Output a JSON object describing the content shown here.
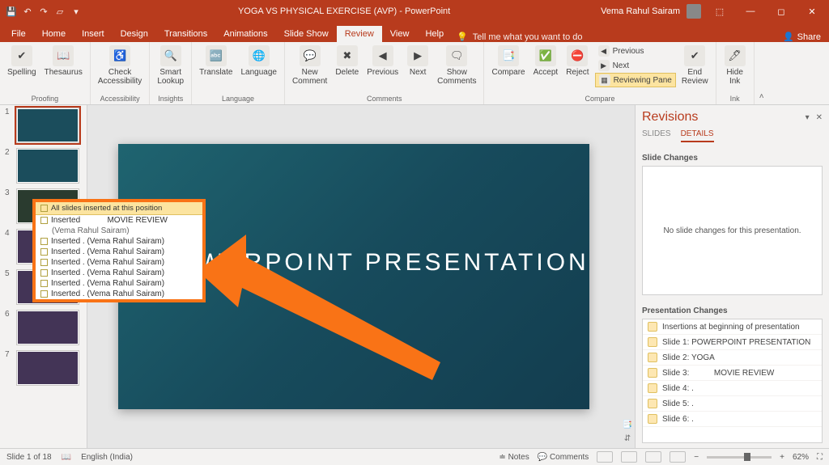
{
  "title": "YOGA VS PHYSICAL EXERCISE (AVP)  -  PowerPoint",
  "user": "Vema Rahul Sairam",
  "tabs": [
    "File",
    "Home",
    "Insert",
    "Design",
    "Transitions",
    "Animations",
    "Slide Show",
    "Review",
    "View",
    "Help"
  ],
  "active_tab": "Review",
  "tellme": "Tell me what you want to do",
  "share": "Share",
  "ribbon": {
    "proofing": {
      "spelling": "Spelling",
      "thesaurus": "Thesaurus"
    },
    "acc": "Check\nAccessibility",
    "insights": "Smart\nLookup",
    "lang": {
      "translate": "Translate",
      "language": "Language"
    },
    "comments": {
      "new": "New\nComment",
      "del": "Delete",
      "prev": "Previous",
      "next": "Next",
      "show": "Show\nComments"
    },
    "compare": {
      "compare": "Compare",
      "accept": "Accept",
      "reject": "Reject",
      "previous": "Previous",
      "nextr": "Next",
      "pane": "Reviewing Pane",
      "end": "End\nReview"
    },
    "ink": "Hide\nInk",
    "caps": [
      "Proofing",
      "Accessibility",
      "Insights",
      "Language",
      "Comments",
      "Compare",
      "Ink"
    ]
  },
  "callout": {
    "head": "All slides inserted at this position",
    "top": "Inserted            MOVIE REVIEW",
    "sub": "(Vema Rahul Sairam)",
    "line": "Inserted . (Vema Rahul Sairam)"
  },
  "slide_title": "POWERPOINT PRESENTATION",
  "rev": {
    "title": "Revisions",
    "tabs": [
      "SLIDES",
      "DETAILS"
    ],
    "sc": "Slide Changes",
    "sc_msg": "No slide changes for this presentation.",
    "pc": "Presentation Changes",
    "pcs": [
      "Insertions at beginning of presentation",
      "Slide 1: POWERPOINT PRESENTATION",
      "Slide 2: YOGA",
      "Slide 3:           MOVIE REVIEW",
      "Slide 4: .",
      "Slide 5: .",
      "Slide 6: ."
    ]
  },
  "status": {
    "slide": "Slide 1 of 18",
    "lang": "English (India)",
    "notes": "Notes",
    "comments": "Comments",
    "zoom": "62%"
  }
}
